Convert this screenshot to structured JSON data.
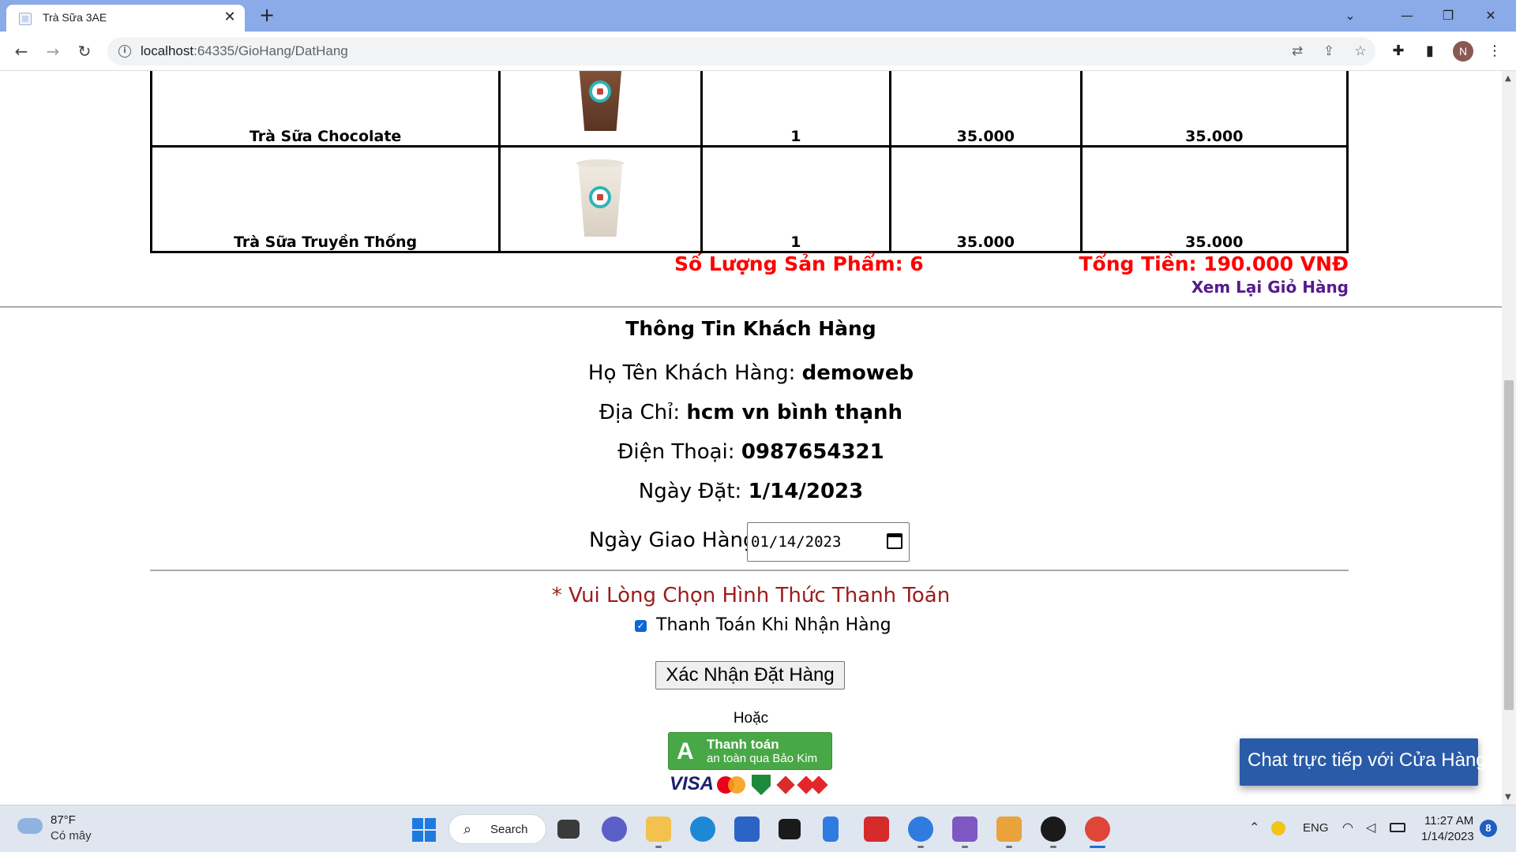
{
  "browser": {
    "tab_title": "Trà Sữa 3AE",
    "url_host": "localhost",
    "url_rest": ":64335/GioHang/DatHang",
    "profile_initial": "N"
  },
  "cart": {
    "rows": [
      {
        "name": "Trà Sữa Chocolate",
        "image": "chocolate-milk-tea-cup",
        "quantity": "1",
        "price": "35.000",
        "subtotal": "35.000"
      },
      {
        "name": "Trà Sữa Truyền Thống",
        "image": "traditional-milk-tea-cup",
        "quantity": "1",
        "price": "35.000",
        "subtotal": "35.000"
      }
    ],
    "quantity_summary": "Số Lượng Sản Phẩm: 6",
    "total_summary": "Tổng Tiền: 190.000 VNĐ",
    "review_link": "Xem Lại Giỏ Hàng"
  },
  "customer": {
    "title": "Thông Tin Khách Hàng",
    "name_label": "Họ Tên Khách Hàng: ",
    "name_value": "demoweb",
    "address_label": "Địa Chỉ: ",
    "address_value": "hcm vn bình thạnh",
    "phone_label": "Điện Thoại: ",
    "phone_value": "0987654321",
    "order_date_label": "Ngày Đặt: ",
    "order_date_value": "1/14/2023",
    "delivery_label": "Ngày Giao Hàng:",
    "delivery_value": "01/14/2023"
  },
  "payment": {
    "prompt": "* Vui Lòng Chọn Hình Thức Thanh Toán",
    "cod_option": "Thanh Toán Khi Nhận Hàng",
    "cod_checked": true,
    "confirm_button": "Xác Nhận Đặt Hàng",
    "or_text": "Hoặc",
    "baokim_line1": "Thanh toán",
    "baokim_line2": "an toàn qua Bảo Kim",
    "card_visa": "VISA"
  },
  "chat": {
    "label": "Chat trực tiếp với Cửa Hàng"
  },
  "taskbar": {
    "temperature": "87°F",
    "weather": "Có mây",
    "search_label": "Search",
    "language": "ENG",
    "time": "11:27 AM",
    "date": "1/14/2023",
    "notification_count": "8"
  },
  "colors": {
    "accent_red": "#ff0000",
    "link_purple": "#551a8b",
    "prompt_red": "#9b1c1c",
    "chat_blue": "#2a5ba8",
    "baokim_green": "#48a846"
  }
}
